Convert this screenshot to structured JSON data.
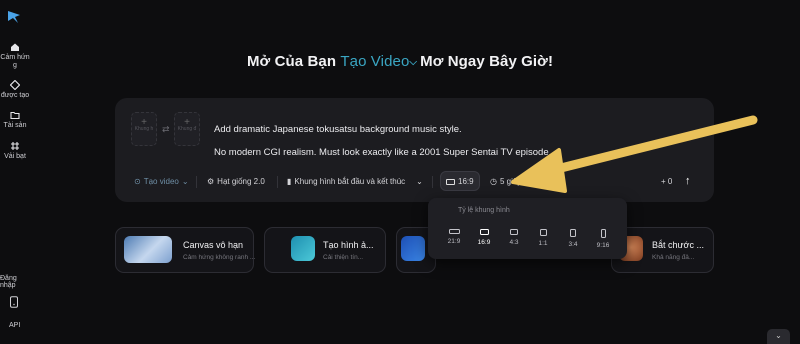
{
  "sidebar": {
    "items": [
      {
        "label": "Cảm hứn\ng",
        "icon": "home-icon"
      },
      {
        "label": "được tạo",
        "icon": "diamond-icon"
      },
      {
        "label": "Tài sản",
        "icon": "folder-icon"
      },
      {
        "label": "Vải bạt",
        "icon": "canvas-grid-icon"
      }
    ],
    "login_label": "Đăng nhập",
    "api_label": "API"
  },
  "headline": {
    "before": "Mở Của Bạn ",
    "accent": "Tạo Video",
    "chevron": "⌵",
    "after": "Mơ Ngay Bây Giờ!"
  },
  "composer": {
    "frame_label": "Khung h",
    "frame_label2": "Khung đ",
    "prompt_line1": "Add dramatic Japanese tokusatsu background music style.",
    "prompt_line2": "No modern CGI realism. Must look exactly like a 2001 Super Sentai TV episode.",
    "toolbar": {
      "mode": "Tạo video",
      "seed": "Hạt giống 2.0",
      "frames": "Khung hình bắt đầu và kết thúc",
      "ratio": "16:9",
      "duration": "5 giây",
      "credits": "+ 0"
    }
  },
  "ratio_menu": {
    "title": "Tỷ lệ khung hình",
    "title_shown": "Tỷ lệ khung hình",
    "options": [
      "21:9",
      "16:9",
      "4:3",
      "1:1",
      "3:4",
      "9:16"
    ],
    "selected": "16:9"
  },
  "cards": [
    {
      "title": "Canvas vô hạn",
      "subtitle": "Cảm hứng không ranh ..."
    },
    {
      "title": "Tạo hình ả...",
      "subtitle": "Cải thiện tín..."
    },
    {
      "title": "",
      "subtitle": ""
    },
    {
      "title": "Bắt chước ...",
      "subtitle": "Khả năng đả..."
    }
  ],
  "colors": {
    "accent": "#3aa6c3",
    "arrow": "#e9c15a",
    "background": "#0d0d0f",
    "panel": "#1c1c20"
  }
}
